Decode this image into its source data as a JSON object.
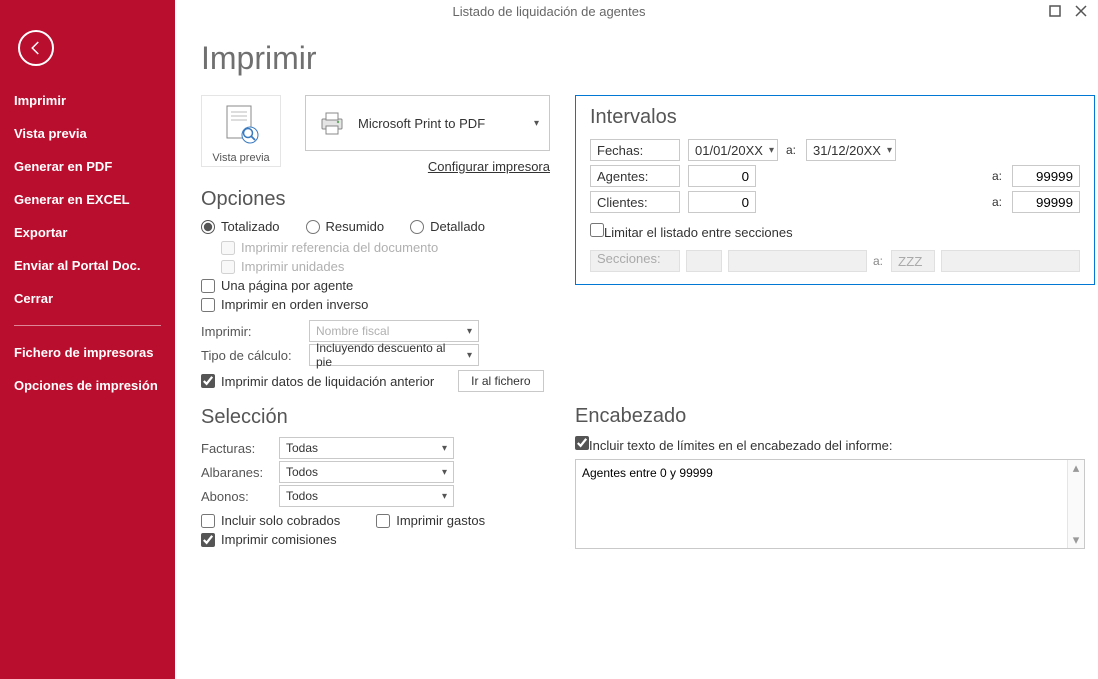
{
  "title": "Listado de liquidación de agentes",
  "sidebar": {
    "items": [
      "Imprimir",
      "Vista previa",
      "Generar en PDF",
      "Generar en EXCEL",
      "Exportar",
      "Enviar al Portal Doc.",
      "Cerrar",
      "Fichero de impresoras",
      "Opciones de impresión"
    ]
  },
  "heading": "Imprimir",
  "preview_label": "Vista previa",
  "printer_name": "Microsoft Print to PDF",
  "configure_printer": "Configurar impresora",
  "opciones": {
    "title": "Opciones",
    "radio_totalizado": "Totalizado",
    "radio_resumido": "Resumido",
    "radio_detallado": "Detallado",
    "chk_ref_doc": "Imprimir referencia del documento",
    "chk_unidades": "Imprimir unidades",
    "chk_una_pagina": "Una página por agente",
    "chk_orden_inverso": "Imprimir en orden inverso",
    "lbl_imprimir": "Imprimir:",
    "sel_imprimir": "Nombre fiscal",
    "lbl_tipocalc": "Tipo de cálculo:",
    "sel_tipocalc": "Incluyendo descuento al pie",
    "chk_datos_liq": "Imprimir datos de liquidación anterior",
    "btn_ir_fichero": "Ir al fichero"
  },
  "seleccion": {
    "title": "Selección",
    "lbl_facturas": "Facturas:",
    "sel_facturas": "Todas",
    "lbl_albaranes": "Albaranes:",
    "sel_albaranes": "Todos",
    "lbl_abonos": "Abonos:",
    "sel_abonos": "Todos",
    "chk_cobrados": "Incluir solo cobrados",
    "chk_gastos": "Imprimir gastos",
    "chk_comisiones": "Imprimir comisiones"
  },
  "intervalos": {
    "title": "Intervalos",
    "lbl_fechas": "Fechas:",
    "fecha_desde": "01/01/20XX",
    "fecha_hasta": "31/12/20XX",
    "lbl_agentes": "Agentes:",
    "agentes_desde": "0",
    "agentes_hasta": "99999",
    "lbl_clientes": "Clientes:",
    "clientes_desde": "0",
    "clientes_hasta": "99999",
    "chk_limitar": "Limitar el listado entre secciones",
    "lbl_secciones": "Secciones:",
    "secciones_hasta_ph": "ZZZ",
    "to": "a:"
  },
  "encabezado": {
    "title": "Encabezado",
    "chk_incluir": "Incluir texto de límites en el encabezado del informe:",
    "text": "Agentes entre 0 y 99999"
  }
}
